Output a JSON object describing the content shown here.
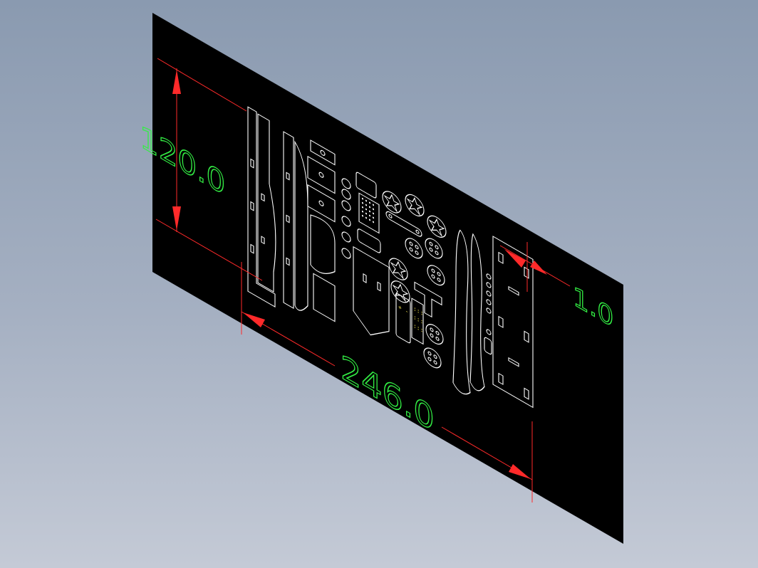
{
  "viewport": {
    "background_top": "#8a9ab0",
    "background_bottom": "#c4cad6"
  },
  "sheet": {
    "color": "#000000",
    "part_color": "#ffffff"
  },
  "dimensions": {
    "height_label": "120.0",
    "width_label": "246.0",
    "thickness_label": "1.0",
    "line_color": "#ff2a2a",
    "text_color": "#33ee44"
  },
  "markings": {
    "color": "#f1e24a"
  }
}
